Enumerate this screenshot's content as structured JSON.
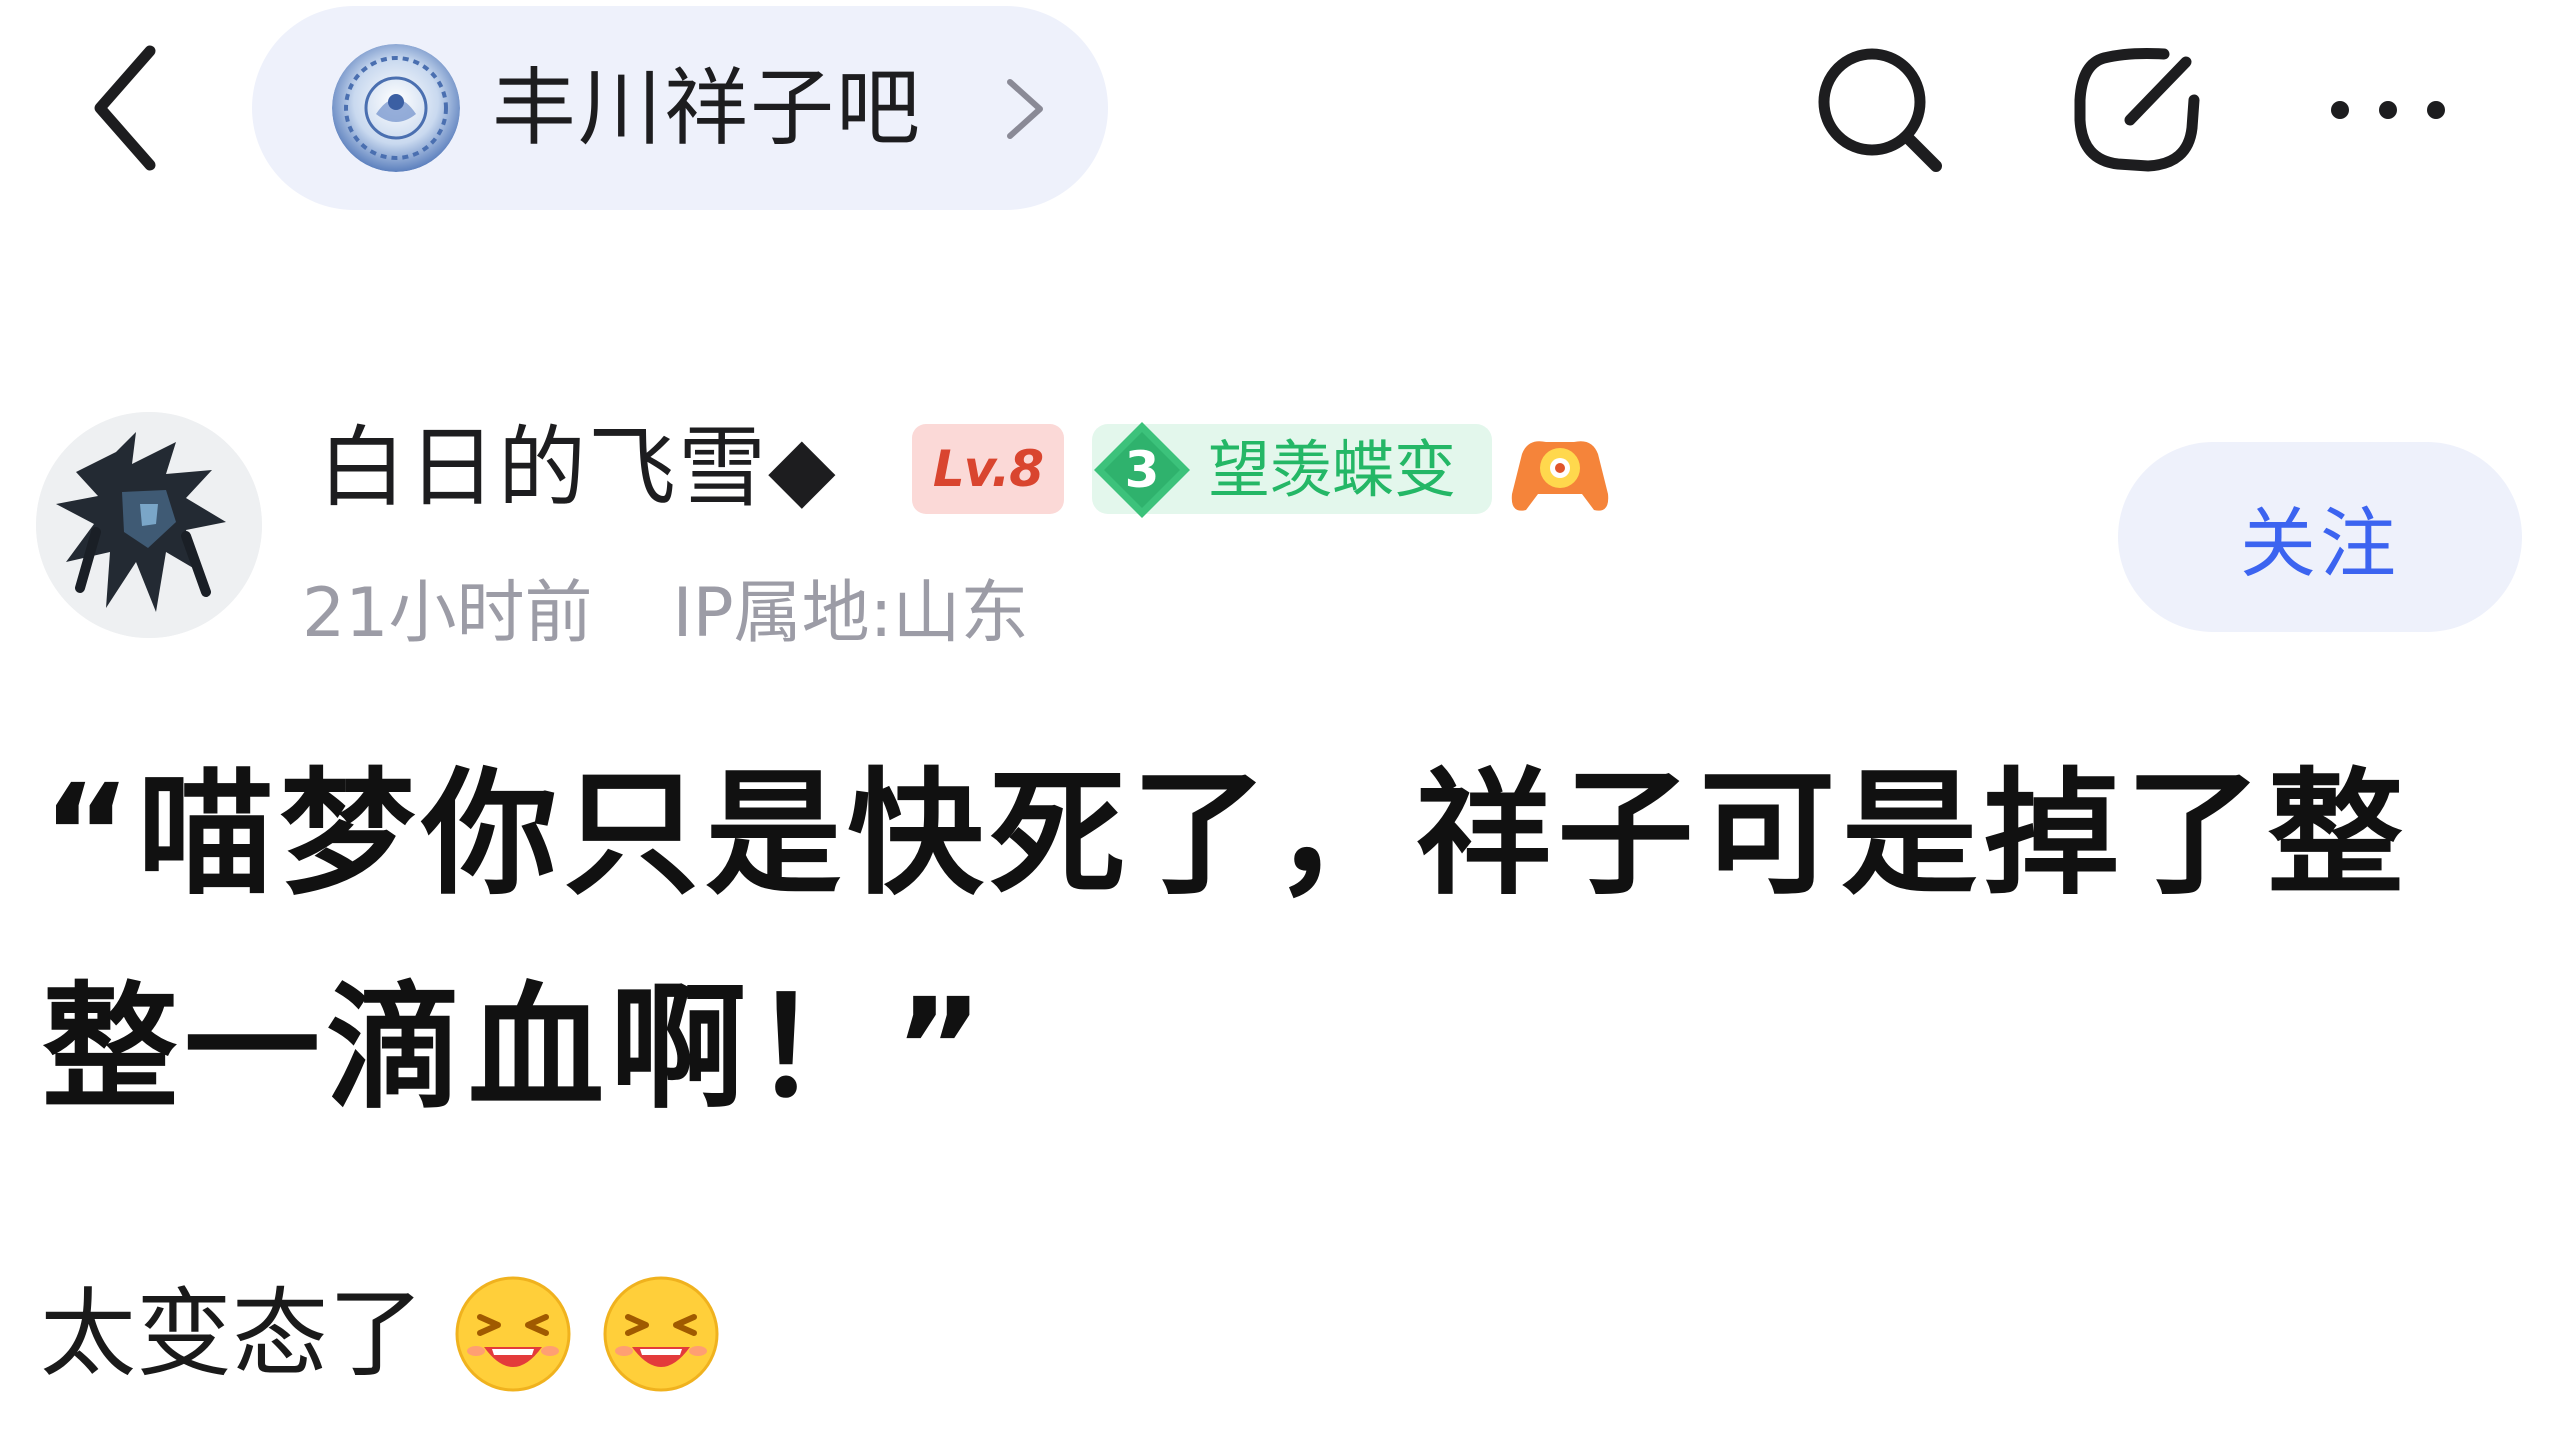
{
  "header": {
    "forum_name": "丰川祥子吧",
    "back_icon": "chevron-left-icon",
    "forum_chevron_icon": "chevron-right-icon",
    "actions": [
      {
        "name": "search",
        "icon": "search-icon"
      },
      {
        "name": "share",
        "icon": "share-icon"
      },
      {
        "name": "more",
        "icon": "more-icon"
      }
    ]
  },
  "author": {
    "name": "白日的飞雪◆",
    "level_badge": "Lv.8",
    "title_badge": {
      "number": "3",
      "text": "望羡蝶变"
    },
    "game_badge_icon": "gamepad-badge-icon",
    "time": "21小时前",
    "ip_location": "IP属地:山东",
    "follow_label": "关注"
  },
  "post": {
    "title": "“喵梦你只是快死了，祥子可是掉了整整一滴血啊！”",
    "content": "太变态了",
    "emojis": [
      "laughing-emoji",
      "laughing-emoji"
    ]
  },
  "colors": {
    "accent": "#3c64f0",
    "pill_bg": "#eef1fb",
    "level_badge_bg": "#fbd9d7",
    "level_badge_text": "#d9452f",
    "title_badge_bg": "#e3f7ec",
    "title_badge_text": "#24b766",
    "meta_text": "#9c9ca6"
  }
}
